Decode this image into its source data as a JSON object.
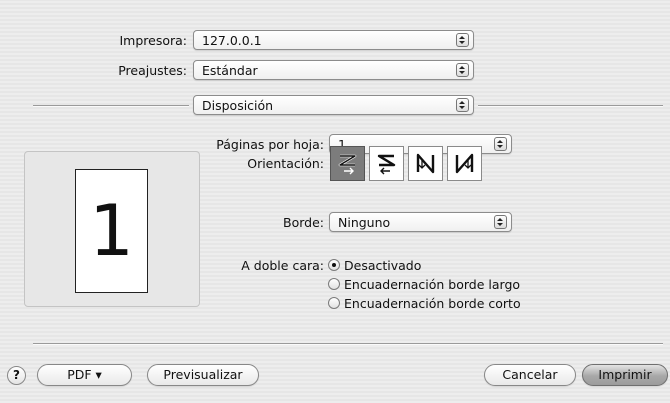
{
  "printer": {
    "label": "Impresora:",
    "value": "127.0.0.1"
  },
  "presets": {
    "label": "Preajustes:",
    "value": "Estándar"
  },
  "pane": {
    "value": "Disposición"
  },
  "preview": {
    "page_number": "1"
  },
  "layout": {
    "pages_per_sheet": {
      "label": "Páginas por hoja:",
      "value": "1"
    },
    "orientation": {
      "label": "Orientación:",
      "selected_index": 0,
      "options": [
        "z-pattern-icon",
        "reverse-z-pattern-icon",
        "n-pattern-icon",
        "reverse-n-pattern-icon"
      ]
    },
    "border": {
      "label": "Borde:",
      "value": "Ninguno"
    },
    "two_sided": {
      "label": "A doble cara:",
      "options": [
        {
          "label": "Desactivado",
          "selected": true
        },
        {
          "label": "Encuadernación borde largo",
          "selected": false
        },
        {
          "label": "Encuadernación borde corto",
          "selected": false
        }
      ]
    }
  },
  "footer": {
    "help_label": "?",
    "pdf_label": "PDF ▾",
    "preview_label": "Previsualizar",
    "cancel_label": "Cancelar",
    "print_label": "Imprimir"
  }
}
